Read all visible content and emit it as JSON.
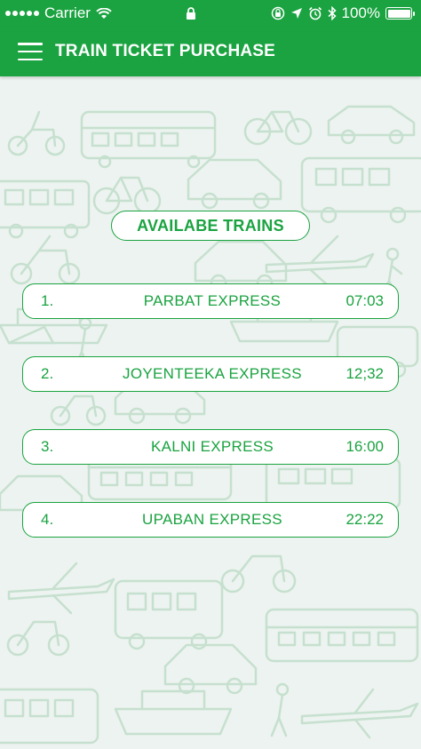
{
  "status_bar": {
    "carrier": "Carrier",
    "battery": "100%"
  },
  "app_bar": {
    "title": "TRAIN TICKET PURCHASE"
  },
  "section": {
    "title": "AVAILABE TRAINS"
  },
  "trains": [
    {
      "number": "1.",
      "name": "PARBAT EXPRESS",
      "time": "07:03"
    },
    {
      "number": "2.",
      "name": "JOYENTEEKA EXPRESS",
      "time": "12;32"
    },
    {
      "number": "3.",
      "name": "KALNI EXPRESS",
      "time": "16:00"
    },
    {
      "number": "4.",
      "name": "UPABAN EXPRESS",
      "time": "22:22"
    }
  ],
  "colors": {
    "primary": "#1aa340",
    "background": "#edf3f0",
    "pattern": "#c9e3d2"
  }
}
